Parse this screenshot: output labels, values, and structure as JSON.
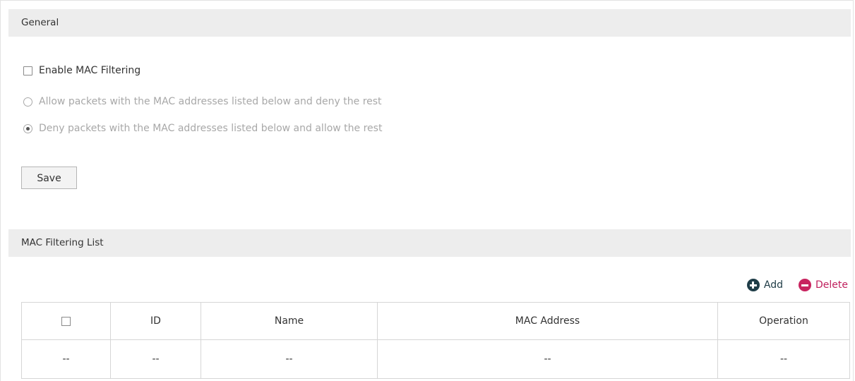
{
  "general": {
    "header": "General",
    "enable_label": "Enable MAC Filtering",
    "enable_checked": false,
    "options": [
      {
        "label": "Allow packets with the MAC addresses listed below and deny the rest",
        "selected": false
      },
      {
        "label": "Deny packets with the MAC addresses listed below and allow the rest",
        "selected": true
      }
    ],
    "save_label": "Save"
  },
  "list": {
    "header": "MAC Filtering List",
    "add_label": "Add",
    "delete_label": "Delete",
    "add_icon": "plus-circle-icon",
    "delete_icon": "minus-circle-icon",
    "columns": [
      "ID",
      "Name",
      "MAC Address",
      "Operation"
    ],
    "rows": [
      {
        "select": "--",
        "id": "--",
        "name": "--",
        "mac": "--",
        "operation": "--"
      }
    ]
  },
  "colors": {
    "header_bg": "#ededed",
    "add": "#1f3d48",
    "delete": "#c8235f",
    "dim_text": "#a8a8a8"
  }
}
